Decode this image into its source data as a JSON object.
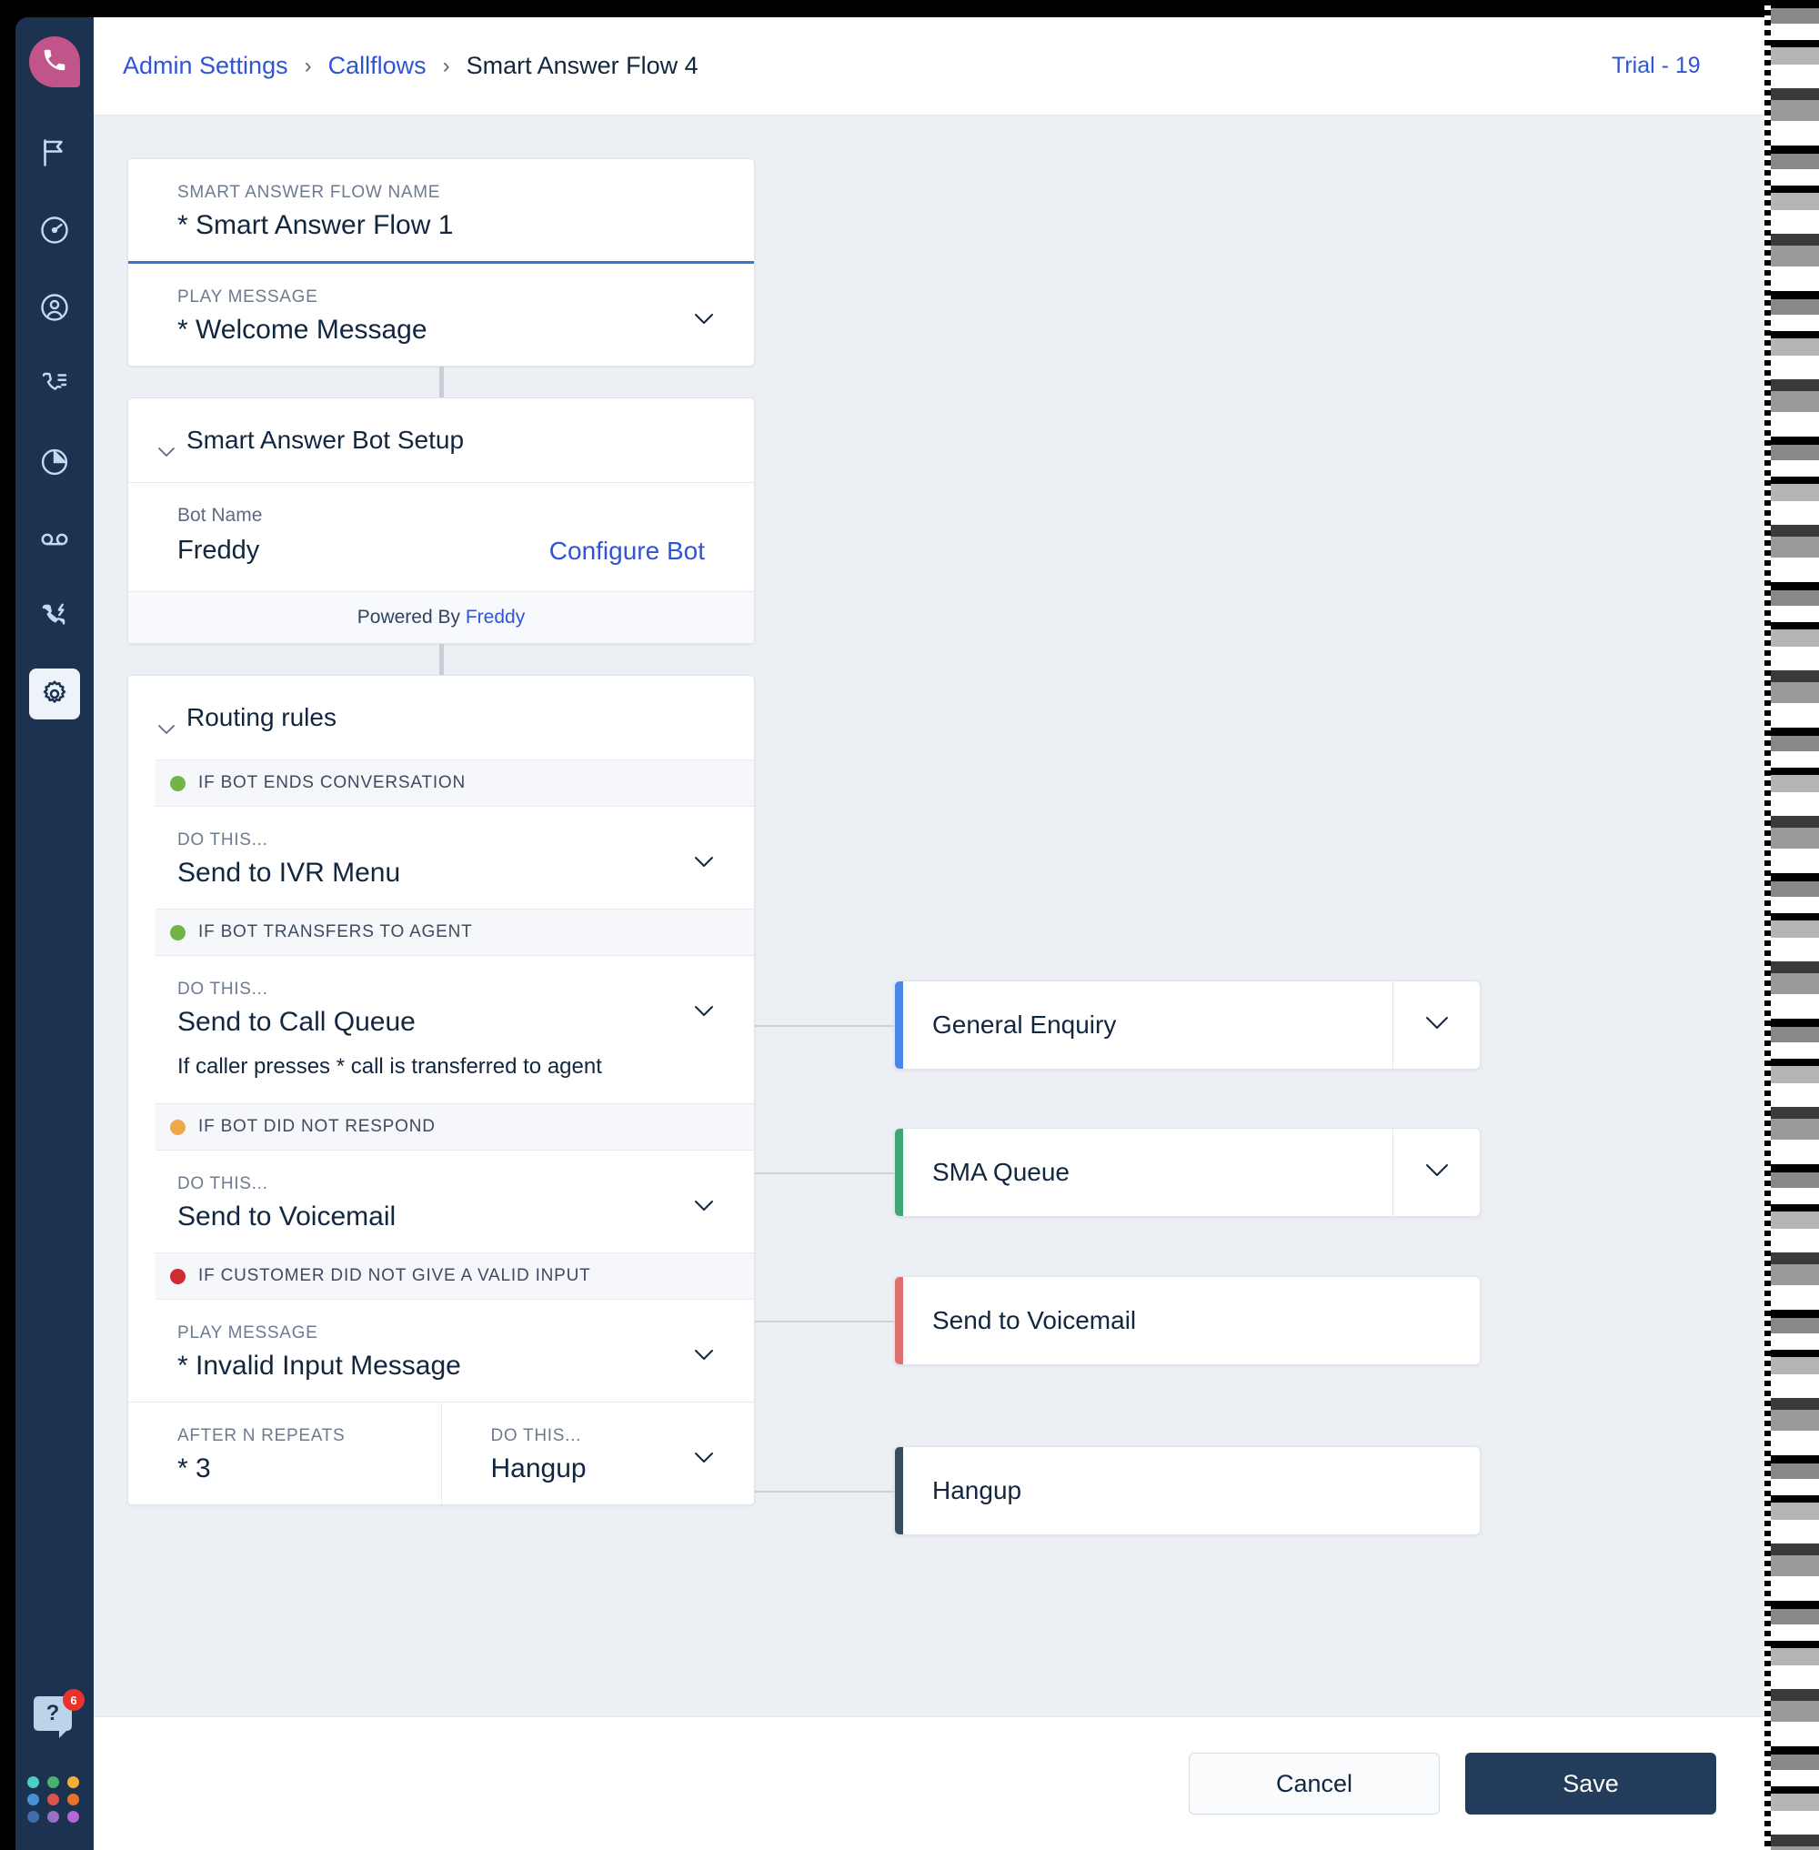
{
  "breadcrumb": {
    "items": [
      {
        "label": "Admin Settings",
        "type": "link"
      },
      {
        "label": "Callflows",
        "type": "link"
      },
      {
        "label": "Smart Answer Flow 4",
        "type": "current"
      }
    ],
    "separator": "›"
  },
  "topbar": {
    "trial_label": "Trial - 19"
  },
  "sidebar": {
    "logo_icon": "phone-logo-icon",
    "logo_color": "#c15589",
    "items": [
      {
        "icon": "flag-icon",
        "active": false
      },
      {
        "icon": "speedometer-icon",
        "active": false
      },
      {
        "icon": "user-circle-icon",
        "active": false
      },
      {
        "icon": "call-list-icon",
        "active": false
      },
      {
        "icon": "pie-chart-icon",
        "active": false
      },
      {
        "icon": "voicemail-icon",
        "active": false
      },
      {
        "icon": "power-dialer-icon",
        "active": false
      },
      {
        "icon": "gear-icon",
        "active": true
      }
    ],
    "help": {
      "icon": "help-question-icon",
      "badge": "6"
    },
    "app_switcher": {
      "icon": "app-grid-icon",
      "colors": [
        "#4ecdc4",
        "#4caf72",
        "#f2b134",
        "#4a90d9",
        "#d9534f",
        "#e8722c",
        "#3f6fa8",
        "#9b6fc4",
        "#b467d6"
      ]
    }
  },
  "flow": {
    "name_field": {
      "label": "SMART ANSWER FLOW NAME",
      "value": "* Smart Answer Flow 1"
    },
    "play_message_field": {
      "label": "PLAY MESSAGE",
      "value": "* Welcome Message",
      "chevron": "chevron-down-icon"
    },
    "bot_setup": {
      "title": "Smart Answer Bot Setup",
      "bot_name_label": "Bot Name",
      "bot_name_value": "Freddy",
      "configure_link": "Configure Bot",
      "powered_prefix": "Powered By ",
      "powered_brand": "Freddy"
    },
    "routing_rules": {
      "title": "Routing rules",
      "rules": [
        {
          "condition": "IF BOT ENDS CONVERSATION",
          "dot_color": "#71b544",
          "action_label": "DO THIS...",
          "action_value": "Send to IVR Menu",
          "note": ""
        },
        {
          "condition": "IF BOT TRANSFERS TO AGENT",
          "dot_color": "#71b544",
          "action_label": "DO THIS...",
          "action_value": "Send to Call Queue",
          "note": "If caller presses * call is transferred to agent"
        },
        {
          "condition": "IF BOT DID NOT RESPOND",
          "dot_color": "#efa849",
          "action_label": "DO THIS...",
          "action_value": "Send to Voicemail",
          "note": ""
        },
        {
          "condition": "IF CUSTOMER DID NOT GIVE A VALID INPUT",
          "dot_color": "#cf2e2e",
          "action_label": "PLAY MESSAGE",
          "action_value": "* Invalid Input Message",
          "note": ""
        }
      ],
      "repeat_row": {
        "repeats_label": "AFTER N REPEATS",
        "repeats_value": "* 3",
        "action_label": "DO THIS...",
        "action_value": "Hangup"
      }
    }
  },
  "targets": [
    {
      "label": "General Enquiry",
      "accent": "#4a86e8",
      "has_chevron": true
    },
    {
      "label": "SMA Queue",
      "accent": "#3fa776",
      "has_chevron": true
    },
    {
      "label": "Send to Voicemail",
      "accent": "#e0706e",
      "has_chevron": false
    },
    {
      "label": "Hangup",
      "accent": "#3b4b5e",
      "has_chevron": false
    }
  ],
  "footer": {
    "cancel_label": "Cancel",
    "save_label": "Save"
  }
}
